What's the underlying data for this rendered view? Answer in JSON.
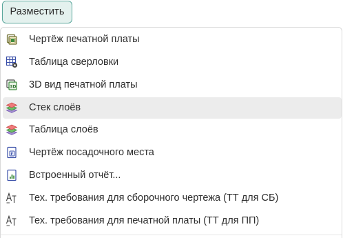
{
  "button": {
    "label": "Разместить"
  },
  "menu": {
    "items": [
      {
        "label": "Чертёж печатной платы",
        "icon": "pcb-drawing-icon"
      },
      {
        "label": "Таблица сверловки",
        "icon": "drill-table-icon"
      },
      {
        "label": "3D вид печатной платы",
        "icon": "pcb-3d-view-icon"
      },
      {
        "label": "Стек слоёв",
        "icon": "layer-stack-icon"
      },
      {
        "label": "Таблица слоёв",
        "icon": "layer-table-icon"
      },
      {
        "label": "Чертёж посадочного места",
        "icon": "footprint-drawing-icon"
      },
      {
        "label": "Встроенный отчёт...",
        "icon": "embedded-report-icon"
      },
      {
        "label": "Тех. требования для сборочного чертежа (ТТ для СБ)",
        "icon": "tech-requirements-icon"
      },
      {
        "label": "Тех. требования для печатной платы (ТТ для ПП)",
        "icon": "tech-requirements-icon"
      }
    ]
  },
  "colors": {
    "accent": "#5aa79c",
    "button_bg": "#e4f1ee",
    "hover": "#ececec"
  }
}
